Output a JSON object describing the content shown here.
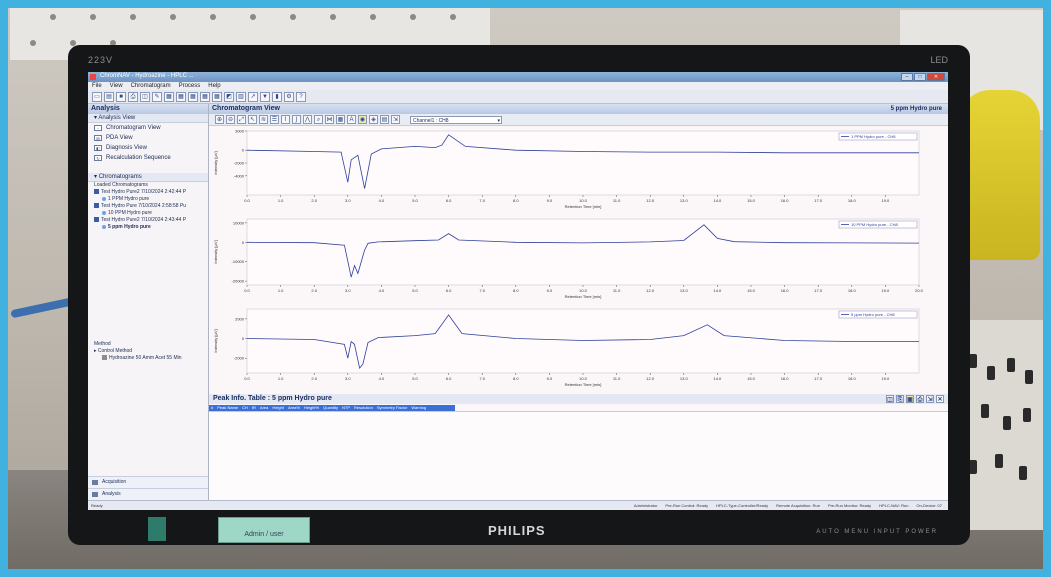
{
  "monitor": {
    "model": "223V",
    "led": "LED",
    "brand": "PHILIPS",
    "sticker": "Admin / user",
    "controls": "AUTO  MENU  INPUT  POWER"
  },
  "window": {
    "title": "ChromNAV - Hydroazine - HPLC ..."
  },
  "menu": [
    "File",
    "View",
    "Chromatogram",
    "Process",
    "Help"
  ],
  "left_panel": {
    "header": "Analysis",
    "section_view": "Analysis View",
    "nav_items": [
      {
        "label": "Chromatogram View",
        "icon": "chromatogram-icon"
      },
      {
        "label": "PDA View",
        "icon": "pda-icon"
      },
      {
        "label": "Diagnosis View",
        "icon": "diagnosis-icon"
      },
      {
        "label": "Recalculation Sequence",
        "icon": "recalc-icon"
      }
    ],
    "section_chromatograms": "Chromatograms",
    "loaded_label": "Loaded Chromatograms",
    "tree": [
      {
        "label": "Test Hydro Pure2 7/10/2024 2:42:44 P",
        "sub": false
      },
      {
        "label": "1 PPM Hydro pure",
        "sub": true
      },
      {
        "label": "Test Hydro Pure 7/10/2024 2:58:58 Pu",
        "sub": false
      },
      {
        "label": "10 PPM Hydro pure",
        "sub": true
      },
      {
        "label": "Test Hydro Pure2 7/10/2024 2:43:44 P",
        "sub": false
      },
      {
        "label": "5 ppm Hydro pure",
        "sub": true
      }
    ],
    "method_label": "Method",
    "method_tree": [
      {
        "label": "Control Method",
        "sub": false
      },
      {
        "label": "Hydroazine 50 Amm Acet 55 Min",
        "sub": true
      }
    ],
    "bottom_nav": [
      "Acquisition",
      "Analysis"
    ]
  },
  "main": {
    "header": "Chromatogram View",
    "header_right": "5 ppm Hydro pure",
    "channel": "Channel1 : CH8",
    "xlabel": "Retention Time [min]",
    "ylabel": "Intensity [µV]"
  },
  "chart_data": [
    {
      "type": "line",
      "series": [
        {
          "name": "1 PPM Hydro pure - CH8",
          "x": [
            0,
            2,
            2.8,
            3.0,
            3.1,
            3.3,
            3.5,
            3.7,
            4.0,
            5.0,
            5.6,
            5.8,
            6.0,
            6.5,
            8,
            10,
            12,
            14,
            16,
            18,
            20
          ],
          "y": [
            0,
            -200,
            -300,
            -5000,
            -1500,
            -800,
            -6000,
            -600,
            200,
            600,
            400,
            800,
            2400,
            600,
            0,
            -200,
            -300,
            -300,
            -400,
            -400,
            -400
          ]
        }
      ],
      "ylim": [
        -7000,
        3000
      ],
      "xlim": [
        0,
        20
      ],
      "yticks": [
        "3000",
        "0",
        "-2000",
        "-4000"
      ],
      "xticks": [
        "0.0",
        "1.0",
        "2.0",
        "3.0",
        "4.0",
        "5.0",
        "6.0",
        "7.0",
        "8.0",
        "9.0",
        "10.0",
        "11.0",
        "12.0",
        "13.0",
        "14.0",
        "15.0",
        "16.0",
        "17.0",
        "18.0",
        "19.0"
      ],
      "legend": "1 PPM Hydro pure - CH8",
      "ylabel": "Intensity [µV]",
      "xlabel": "Retention Time [min]"
    },
    {
      "type": "line",
      "series": [
        {
          "name": "10 PPM Hydro pure - CH8",
          "x": [
            0,
            2,
            2.9,
            3.1,
            3.2,
            3.3,
            3.5,
            3.6,
            3.9,
            5.0,
            5.7,
            6.0,
            6.3,
            8,
            10,
            12,
            13,
            13.6,
            14.0,
            14.5,
            16,
            18,
            20
          ],
          "y": [
            0,
            -200,
            -1500,
            -18000,
            -12000,
            -16000,
            -4000,
            -500,
            200,
            800,
            1200,
            4500,
            1200,
            0,
            -300,
            200,
            900,
            9000,
            2000,
            300,
            -200,
            -300,
            -400
          ]
        }
      ],
      "ylim": [
        -22000,
        12000
      ],
      "xlim": [
        0,
        20
      ],
      "yticks": [
        "10000",
        "0",
        "-10000",
        "-20000"
      ],
      "xticks": [
        "0.0",
        "1.0",
        "2.0",
        "3.0",
        "4.0",
        "5.0",
        "6.0",
        "7.0",
        "8.0",
        "9.0",
        "10.0",
        "11.0",
        "12.0",
        "13.0",
        "14.0",
        "15.0",
        "16.0",
        "17.0",
        "18.0",
        "19.0",
        "20.0"
      ],
      "legend": "10 PPM Hydro pure - CH8",
      "ylabel": "Intensity [µV]",
      "xlabel": "Retention Time [min]"
    },
    {
      "type": "line",
      "series": [
        {
          "name": "5 ppm Hydro pure - CH8",
          "x": [
            0,
            2,
            2.9,
            3.0,
            3.1,
            3.2,
            3.35,
            3.45,
            3.6,
            3.9,
            5.0,
            5.6,
            6.0,
            6.4,
            8,
            10,
            12,
            13,
            13.7,
            14.2,
            16,
            18,
            20
          ],
          "y": [
            0,
            -100,
            -600,
            -2000,
            -300,
            -600,
            -3000,
            -2600,
            -400,
            100,
            300,
            500,
            2400,
            500,
            0,
            -200,
            -100,
            300,
            1400,
            300,
            -200,
            -300,
            -300
          ]
        }
      ],
      "ylim": [
        -3500,
        3000
      ],
      "xlim": [
        0,
        20
      ],
      "yticks": [
        "2000",
        "0",
        "-2000"
      ],
      "xticks": [
        "0.0",
        "1.0",
        "2.0",
        "3.0",
        "4.0",
        "5.0",
        "6.0",
        "7.0",
        "8.0",
        "9.0",
        "10.0",
        "11.0",
        "12.0",
        "13.0",
        "14.0",
        "15.0",
        "16.0",
        "17.0",
        "18.0",
        "19.0"
      ],
      "legend": "5 ppm Hydro pure - CH8",
      "ylabel": "Intensity [µV]",
      "xlabel": "Retention Time [min]"
    }
  ],
  "peak_table": {
    "title": "Peak Info. Table : 5 ppm Hydro pure",
    "columns": [
      "#",
      "Peak Name",
      "CH",
      "tR",
      "Area",
      "Height",
      "Area%",
      "Height%",
      "Quantity",
      "NTP",
      "Resolution",
      "Symmetry Factor",
      "Warning"
    ]
  },
  "status": {
    "left": "Ready",
    "right": [
      "Administrator",
      "Pre-Run Control: Ready",
      "HPLC-Type-Controller/Ready",
      "Remote Acquisition: Run",
      "Pre-Run Monitor: Ready",
      "HPLC-NAV: Run",
      "On-Device: 07"
    ]
  }
}
